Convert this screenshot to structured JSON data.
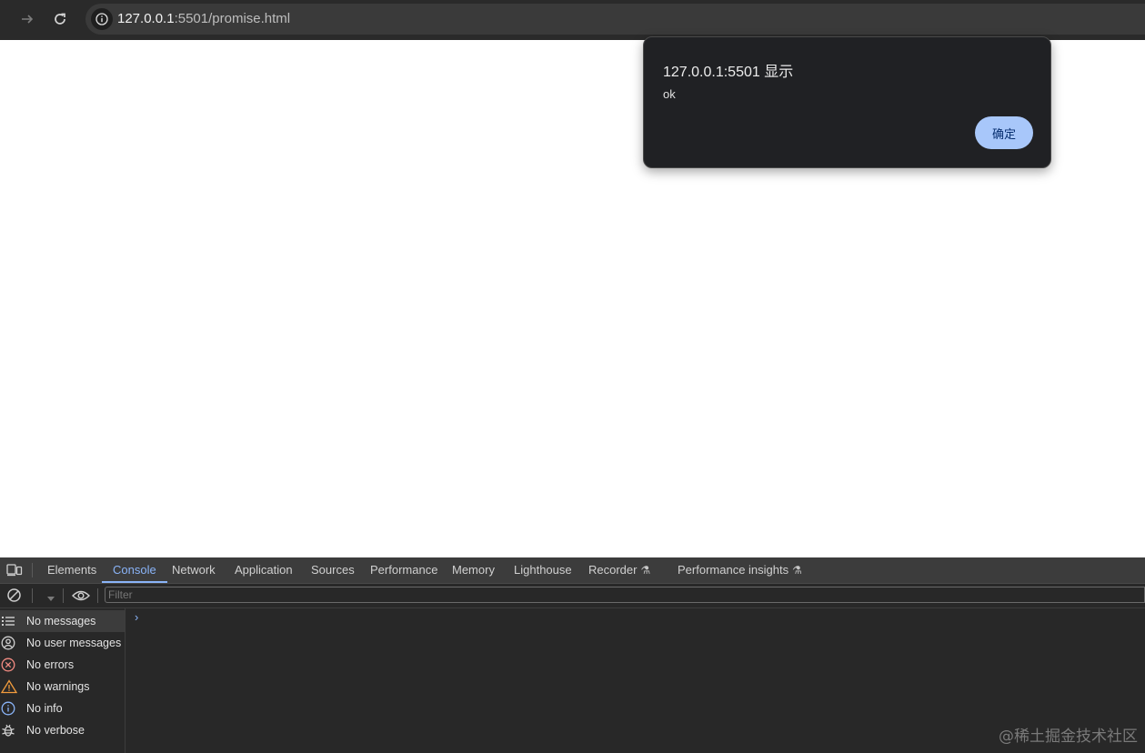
{
  "browser": {
    "url_host": "127.0.0.1",
    "url_rest": ":5501/promise.html"
  },
  "dialog": {
    "title": "127.0.0.1:5501 显示",
    "message": "ok",
    "ok_label": "确定"
  },
  "devtools": {
    "tabs": [
      {
        "label": "Elements"
      },
      {
        "label": "Console"
      },
      {
        "label": "Network"
      },
      {
        "label": "Application"
      },
      {
        "label": "Sources"
      },
      {
        "label": "Performance"
      },
      {
        "label": "Memory"
      },
      {
        "label": "Lighthouse"
      },
      {
        "label": "Recorder"
      },
      {
        "label": "Performance insights"
      }
    ],
    "active_tab": "Console",
    "filter_placeholder": "Filter",
    "sidebar": [
      {
        "label": "No messages",
        "icon": "list-icon"
      },
      {
        "label": "No user messages",
        "icon": "user-circle-icon"
      },
      {
        "label": "No errors",
        "icon": "error-icon"
      },
      {
        "label": "No warnings",
        "icon": "warning-icon"
      },
      {
        "label": "No info",
        "icon": "info-icon"
      },
      {
        "label": "No verbose",
        "icon": "bug-icon"
      }
    ],
    "prompt": "›"
  },
  "watermark": "@稀土掘金技术社区",
  "colors": {
    "accent": "#8ab4f8",
    "dialog_button": "#a8c7fa",
    "error": "#f28b82",
    "warning": "#f29c3d"
  }
}
